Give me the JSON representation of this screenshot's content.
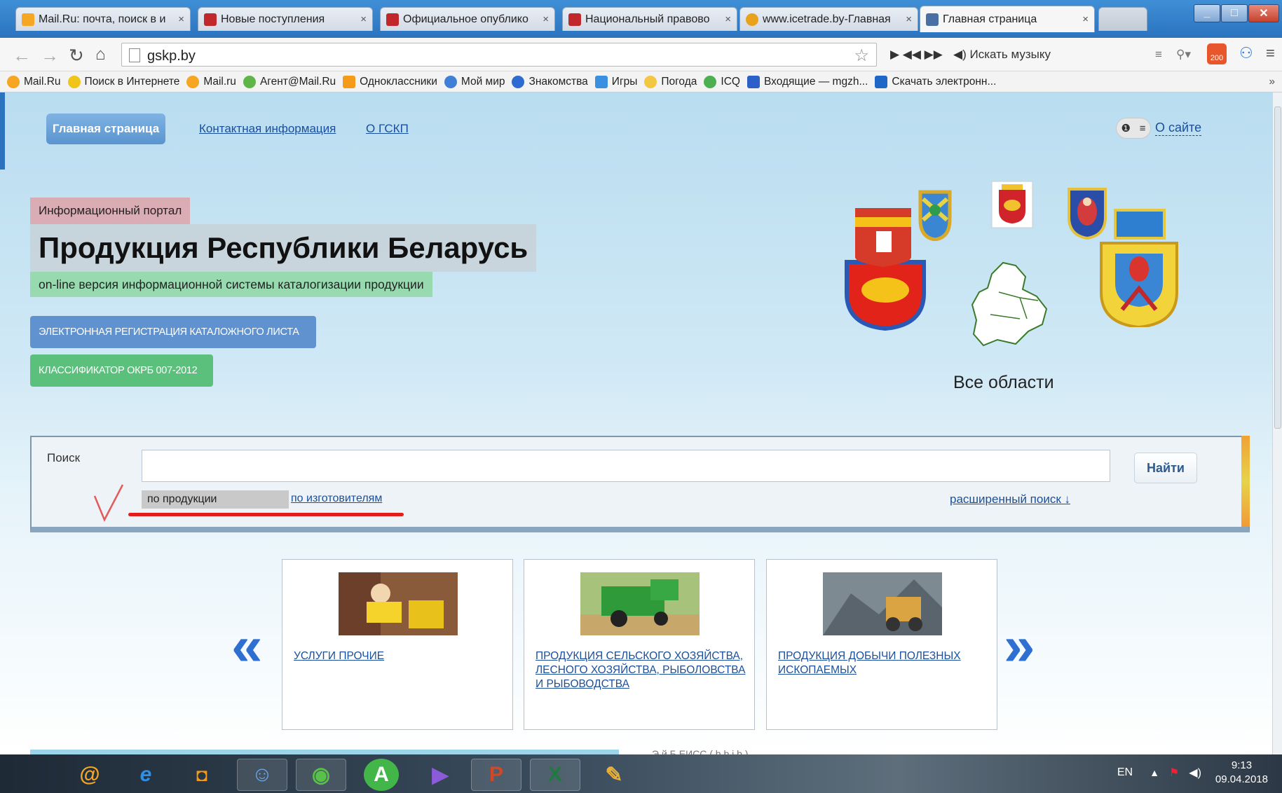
{
  "browser": {
    "tabs": [
      {
        "title": "Mail.Ru: почта, поиск в и",
        "color": "#f5a623"
      },
      {
        "title": "Новые поступления",
        "color": "#c0282b"
      },
      {
        "title": "Официальное опублико",
        "color": "#c0282b"
      },
      {
        "title": "Национальный правово",
        "color": "#c0282b"
      },
      {
        "title": "www.icetrade.by-Главная",
        "color": "#e8a21c"
      },
      {
        "title": "Главная страница",
        "color": "#4a6fa5"
      }
    ],
    "close_glyph": "×",
    "url": "gskp.by",
    "music_placeholder": "Искать музыку",
    "badge_count": "200",
    "bookmarks": [
      {
        "label": "Mail.Ru",
        "color": "#f5a623"
      },
      {
        "label": "Поиск в Интернете",
        "color": "#f0c419"
      },
      {
        "label": "Mail.ru",
        "color": "#f5a623"
      },
      {
        "label": "Агент@Mail.Ru",
        "color": "#5fb548"
      },
      {
        "label": "Одноклассники",
        "color": "#f59b1a"
      },
      {
        "label": "Мой мир",
        "color": "#3f7fd6"
      },
      {
        "label": "Знакомства",
        "color": "#2e6bd0"
      },
      {
        "label": "Игры",
        "color": "#3a8fe0"
      },
      {
        "label": "Погода",
        "color": "#f3c742"
      },
      {
        "label": "ICQ",
        "color": "#4caf50"
      },
      {
        "label": "Входящие — mgzh...",
        "color": "#2d5fc8"
      },
      {
        "label": "Скачать электронн...",
        "color": "#1e66c8"
      }
    ]
  },
  "site": {
    "nav": {
      "home": "Главная страница",
      "contacts": "Контактная информация",
      "about_gskp": "О ГСКП",
      "about_site": "О сайте"
    },
    "hero": {
      "label": "Информационный портал",
      "title": "Продукция Республики Беларусь",
      "subtitle": "on-line версия информационной системы каталогизации продукции",
      "btn_register": "ЭЛЕКТРОННАЯ РЕГИСТРАЦИЯ КАТАЛОЖНОГО ЛИСТА",
      "btn_classifier": "КЛАССИФИКАТОР ОКРБ 007-2012"
    },
    "map_caption": "Все области",
    "search": {
      "label": "Поиск",
      "value": "",
      "button": "Найти",
      "mode_product": "по продукции",
      "mode_maker": "по изготовителям",
      "advanced": "расширенный поиск ↓"
    },
    "carousel": {
      "prev": "«",
      "next": "»",
      "cards": [
        {
          "caption": "УСЛУГИ ПРОЧИЕ"
        },
        {
          "caption": "ПРОДУКЦИЯ СЕЛЬСКОГО ХОЗЯЙСТВА, ЛЕСНОГО ХОЗЯЙСТВА, РЫБОЛОВСТВА И РЫБОВОДСТВА"
        },
        {
          "caption": "ПРОДУКЦИЯ ДОБЫЧИ ПОЛЕЗНЫХ ИСКОПАЕМЫХ"
        }
      ]
    },
    "bottom_text": "Э                    й                    Б   ЕИСС (                    b     b   i   b     )"
  },
  "taskbar": {
    "lang": "EN",
    "time": "9:13",
    "date": "09.04.2018"
  }
}
